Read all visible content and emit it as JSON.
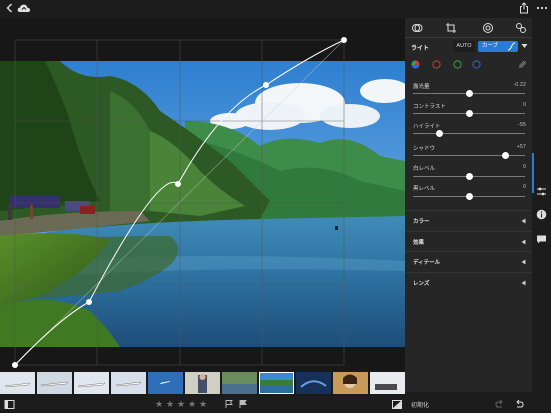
{
  "panel": {
    "light_heading": "ライト",
    "auto_label": "AUTO",
    "curve_label": "カーブ",
    "sliders": [
      {
        "label": "露光量",
        "value": "-0.22",
        "fraction": 0.5
      },
      {
        "label": "コントラスト",
        "value": "0",
        "fraction": 0.5
      },
      {
        "label": "ハイライト",
        "value": "-55",
        "fraction": 0.24
      },
      {
        "label": "シャドウ",
        "value": "+57",
        "fraction": 0.83
      },
      {
        "label": "白レベル",
        "value": "0",
        "fraction": 0.5
      },
      {
        "label": "黒レベル",
        "value": "0",
        "fraction": 0.5
      }
    ],
    "sections": [
      {
        "label": "カラー"
      },
      {
        "label": "効果"
      },
      {
        "label": "ディテール"
      },
      {
        "label": "レンズ"
      }
    ],
    "channel_colors": {
      "rgb": "multi",
      "red": "#d33a3a",
      "green": "#3aa34a",
      "blue": "#3a63d6"
    }
  },
  "bottom": {
    "reset_label": "初期化",
    "rating": 0
  },
  "icons": {
    "back": "chevron-left-icon",
    "cloud": "cloud-sync-icon",
    "share": "share-icon",
    "more": "more-icon"
  },
  "colors": {
    "accent": "#2a7bd6",
    "panel_bg": "#262626",
    "app_bg": "#1c1c1c"
  }
}
